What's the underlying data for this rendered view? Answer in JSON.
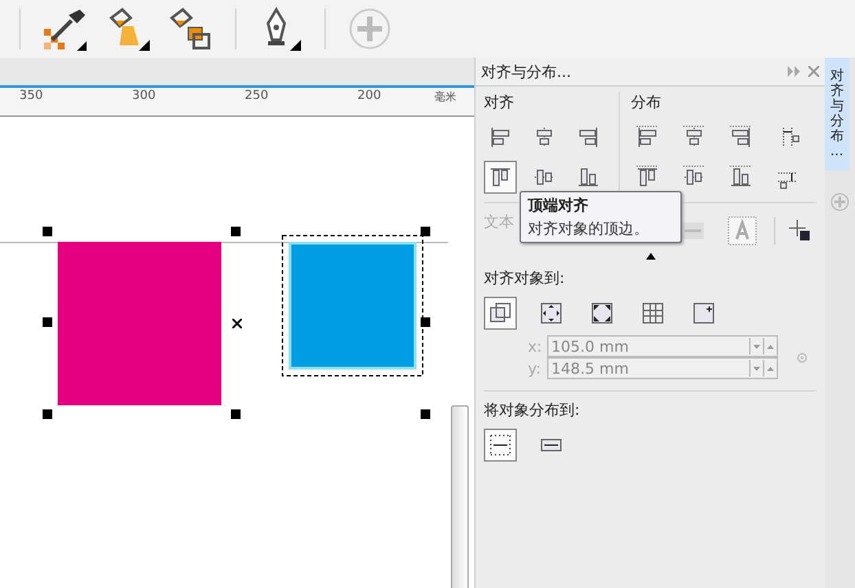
{
  "toolbar": {
    "tools": [
      {
        "kind": "eyedropper"
      },
      {
        "kind": "fill"
      },
      {
        "kind": "copy-fill"
      },
      {
        "kind": "pen"
      },
      {
        "kind": "add"
      }
    ]
  },
  "ruler": {
    "labels": [
      "350",
      "300",
      "250",
      "200"
    ],
    "unit": "毫米"
  },
  "canvas": {
    "shapes": [
      {
        "kind": "rectangle",
        "color": "#e4007f",
        "selected": false
      },
      {
        "kind": "rectangle",
        "color": "#009fe3",
        "selected": true
      }
    ]
  },
  "panel": {
    "title": "对齐与分布...",
    "align": {
      "label": "对齐",
      "buttons": [
        {
          "kind": "left",
          "selected": false
        },
        {
          "kind": "center-h",
          "selected": false
        },
        {
          "kind": "right",
          "selected": false
        },
        {
          "kind": "top",
          "selected": true
        },
        {
          "kind": "center-v",
          "selected": false
        },
        {
          "kind": "bottom",
          "selected": false
        }
      ]
    },
    "distribute": {
      "label": "分布",
      "buttons": [
        {
          "kind": "left",
          "selected": false
        },
        {
          "kind": "center-h",
          "selected": false
        },
        {
          "kind": "right",
          "selected": false
        },
        {
          "kind": "spacing-h",
          "selected": false
        },
        {
          "kind": "top",
          "selected": false
        },
        {
          "kind": "center-v",
          "selected": false
        },
        {
          "kind": "bottom",
          "selected": false
        },
        {
          "kind": "spacing-v",
          "selected": false
        }
      ]
    },
    "text_row": {
      "label": "文本",
      "disabled": true
    },
    "tooltip": {
      "title": "顶端对齐",
      "text": "对齐对象的顶边。"
    },
    "align_to": {
      "label": "对齐对象到:",
      "buttons": [
        {
          "kind": "active",
          "selected": true
        },
        {
          "kind": "page-edge",
          "selected": false
        },
        {
          "kind": "page-center",
          "selected": false
        },
        {
          "kind": "grid",
          "selected": false
        },
        {
          "kind": "point",
          "selected": false
        }
      ],
      "fields": [
        {
          "label": "x:",
          "value": "105.0 mm",
          "disabled": true
        },
        {
          "label": "y:",
          "value": "148.5 mm",
          "disabled": true
        }
      ]
    },
    "distribute_to": {
      "label": "将对象分布到:",
      "buttons": [
        {
          "kind": "extent",
          "selected": true
        },
        {
          "kind": "spacing",
          "selected": false
        }
      ]
    }
  },
  "docker_tabs": [
    {
      "label": "对齐与分布...",
      "selected": true
    }
  ]
}
